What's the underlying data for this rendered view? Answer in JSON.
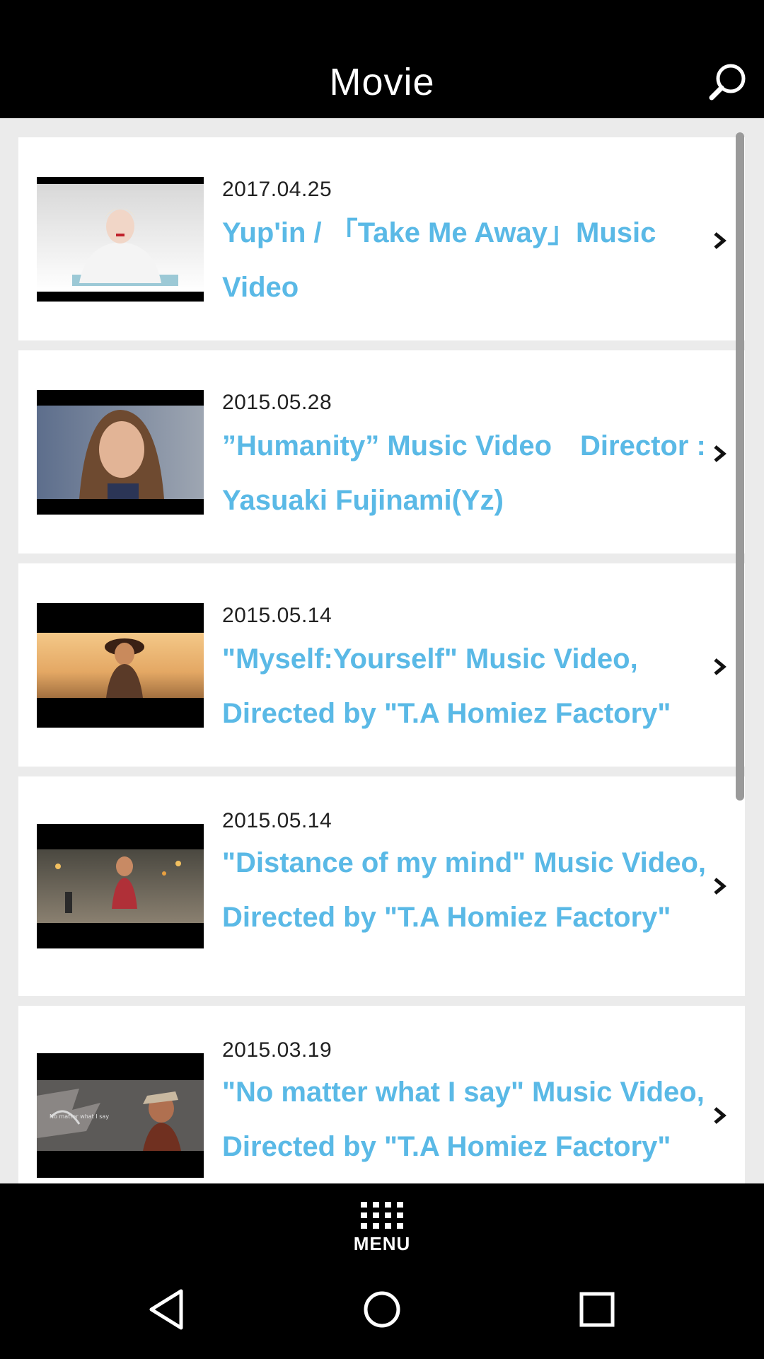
{
  "header": {
    "title": "Movie",
    "search_icon": "search-icon"
  },
  "videos": [
    {
      "date": "2017.04.25",
      "title": "Yup'in / 「Take Me Away」Music Video"
    },
    {
      "date": "2015.05.28",
      "title": "”Humanity” Music Video　Director : Yasuaki Fujinami(Yz)"
    },
    {
      "date": "2015.05.14",
      "title": "\"Myself:Yourself\" Music Video, Directed by \"T.A Homiez Factory\""
    },
    {
      "date": "2015.05.14",
      "title": "\"Distance of my mind\" Music Video,  Directed by \"T.A Homiez Factory\""
    },
    {
      "date": "2015.03.19",
      "title": "\"No matter what I say\" Music Video,  Directed by \"T.A Homiez Factory\""
    }
  ],
  "thumbnail_overlay_text": "No matter what I say",
  "menu": {
    "label": "MENU",
    "icon": "grid-icon"
  },
  "system_nav": {
    "back": "back-icon",
    "home": "home-icon",
    "recents": "recents-icon"
  },
  "colors": {
    "accent": "#5ab9e6",
    "header_bg": "#000000",
    "list_bg": "#ebebeb"
  }
}
